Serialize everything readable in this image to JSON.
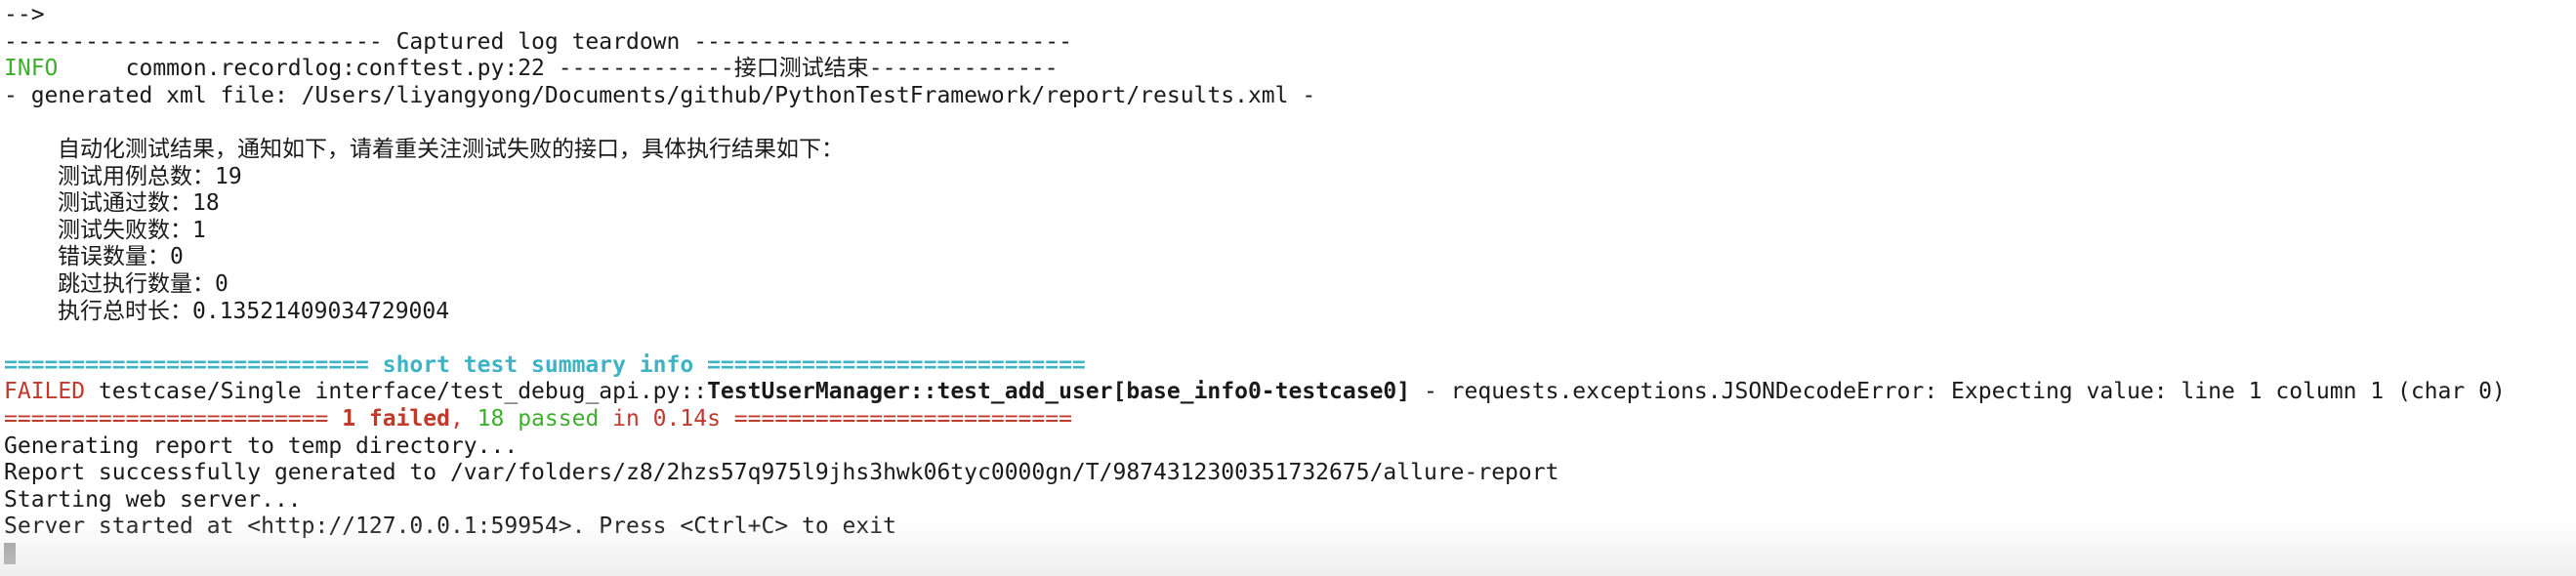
{
  "terminal": {
    "lines": {
      "l0": "-->",
      "l1": "---------------------------- Captured log teardown ----------------------------",
      "l2_level": "INFO",
      "l2_msg": "     common.recordlog:conftest.py:22 -------------接口测试结束--------------",
      "l3": "- generated xml file: /Users/liyangyong/Documents/github/PythonTestFramework/report/results.xml -",
      "l5": "自动化测试结果，通知如下，请着重关注测试失败的接口，具体执行结果如下：",
      "l6": "测试用例总数：19",
      "l7": "测试通过数：18",
      "l8": "测试失败数：1",
      "l9": "错误数量：0",
      "l10": "跳过执行数量：0",
      "l11": "执行总时长：0.13521409034729004",
      "l13": "=========================== short test summary info ============================",
      "l14_status": "FAILED",
      "l14_path": " testcase/Single interface/test_debug_api.py::",
      "l14_test": "TestUserManager::test_add_user[base_info0-testcase0]",
      "l14_error": " - requests.exceptions.JSONDecodeError: Expecting value: line 1 column 1 (char 0)",
      "l15_pre": "======================== ",
      "l15_failed": "1 failed",
      "l15_comma": ", ",
      "l15_passed": "18 passed",
      "l15_time": " in 0.14s",
      "l15_post": " =========================",
      "l16": "Generating report to temp directory...",
      "l17": "Report successfully generated to /var/folders/z8/2hzs57q975l9jhs3hwk06tyc0000gn/T/9874312300351732675/allure-report",
      "l18": "Starting web server...",
      "l19": "Server started at <http://127.0.0.1:59954>. Press <Ctrl+C> to exit"
    }
  },
  "colors": {
    "info": "#3eae2e",
    "failed": "#c0392b",
    "passed": "#3eae2e",
    "summary_header": "#3fb3c4"
  }
}
